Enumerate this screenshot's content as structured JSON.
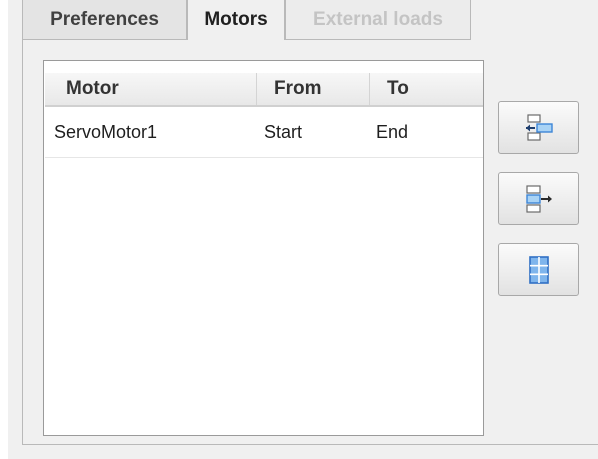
{
  "tabs": [
    {
      "label": "Preferences",
      "state": "inactive"
    },
    {
      "label": "Motors",
      "state": "active"
    },
    {
      "label": "External loads",
      "state": "disabled"
    }
  ],
  "table": {
    "columns": [
      "Motor",
      "From",
      "To"
    ],
    "rows": [
      {
        "motor": "ServoMotor1",
        "from": "Start",
        "to": "End"
      }
    ]
  },
  "side_buttons": [
    {
      "icon": "insert-row-icon"
    },
    {
      "icon": "append-row-icon"
    },
    {
      "icon": "table-grid-icon"
    }
  ],
  "colors": {
    "accent_blue": "#3d86d6",
    "light_blue_fill": "#a9d3f5",
    "disabled_text": "#c4c4c4"
  }
}
